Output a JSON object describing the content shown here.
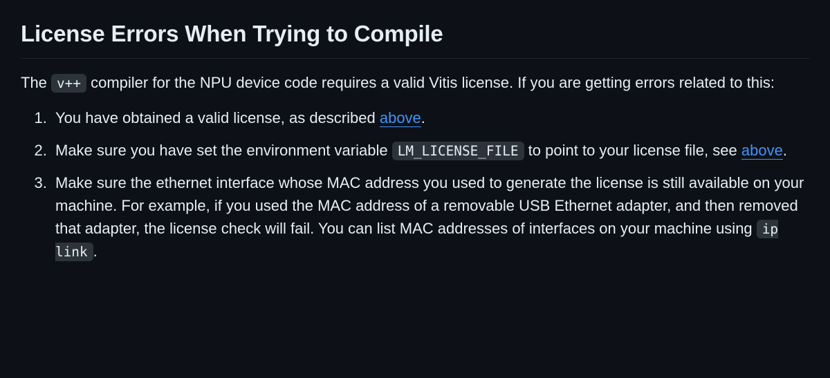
{
  "heading": "License Errors When Trying to Compile",
  "intro": {
    "pre": "The ",
    "code1": "v++",
    "post": " compiler for the NPU device code requires a valid Vitis license. If you are getting errors related to this:"
  },
  "items": [
    {
      "t1": "You have obtained a valid license, as described ",
      "link": "above",
      "t2": "."
    },
    {
      "t1": "Make sure you have set the environment variable ",
      "code": "LM_LICENSE_FILE",
      "t2": " to point to your license file, see ",
      "link": "above",
      "t3": "."
    },
    {
      "t1": "Make sure the ethernet interface whose MAC address you used to generate the license is still available on your machine. For example, if you used the MAC address of a removable USB Ethernet adapter, and then removed that adapter, the license check will fail. You can list MAC addresses of interfaces on your machine using ",
      "code": "ip link",
      "t2": "."
    }
  ]
}
